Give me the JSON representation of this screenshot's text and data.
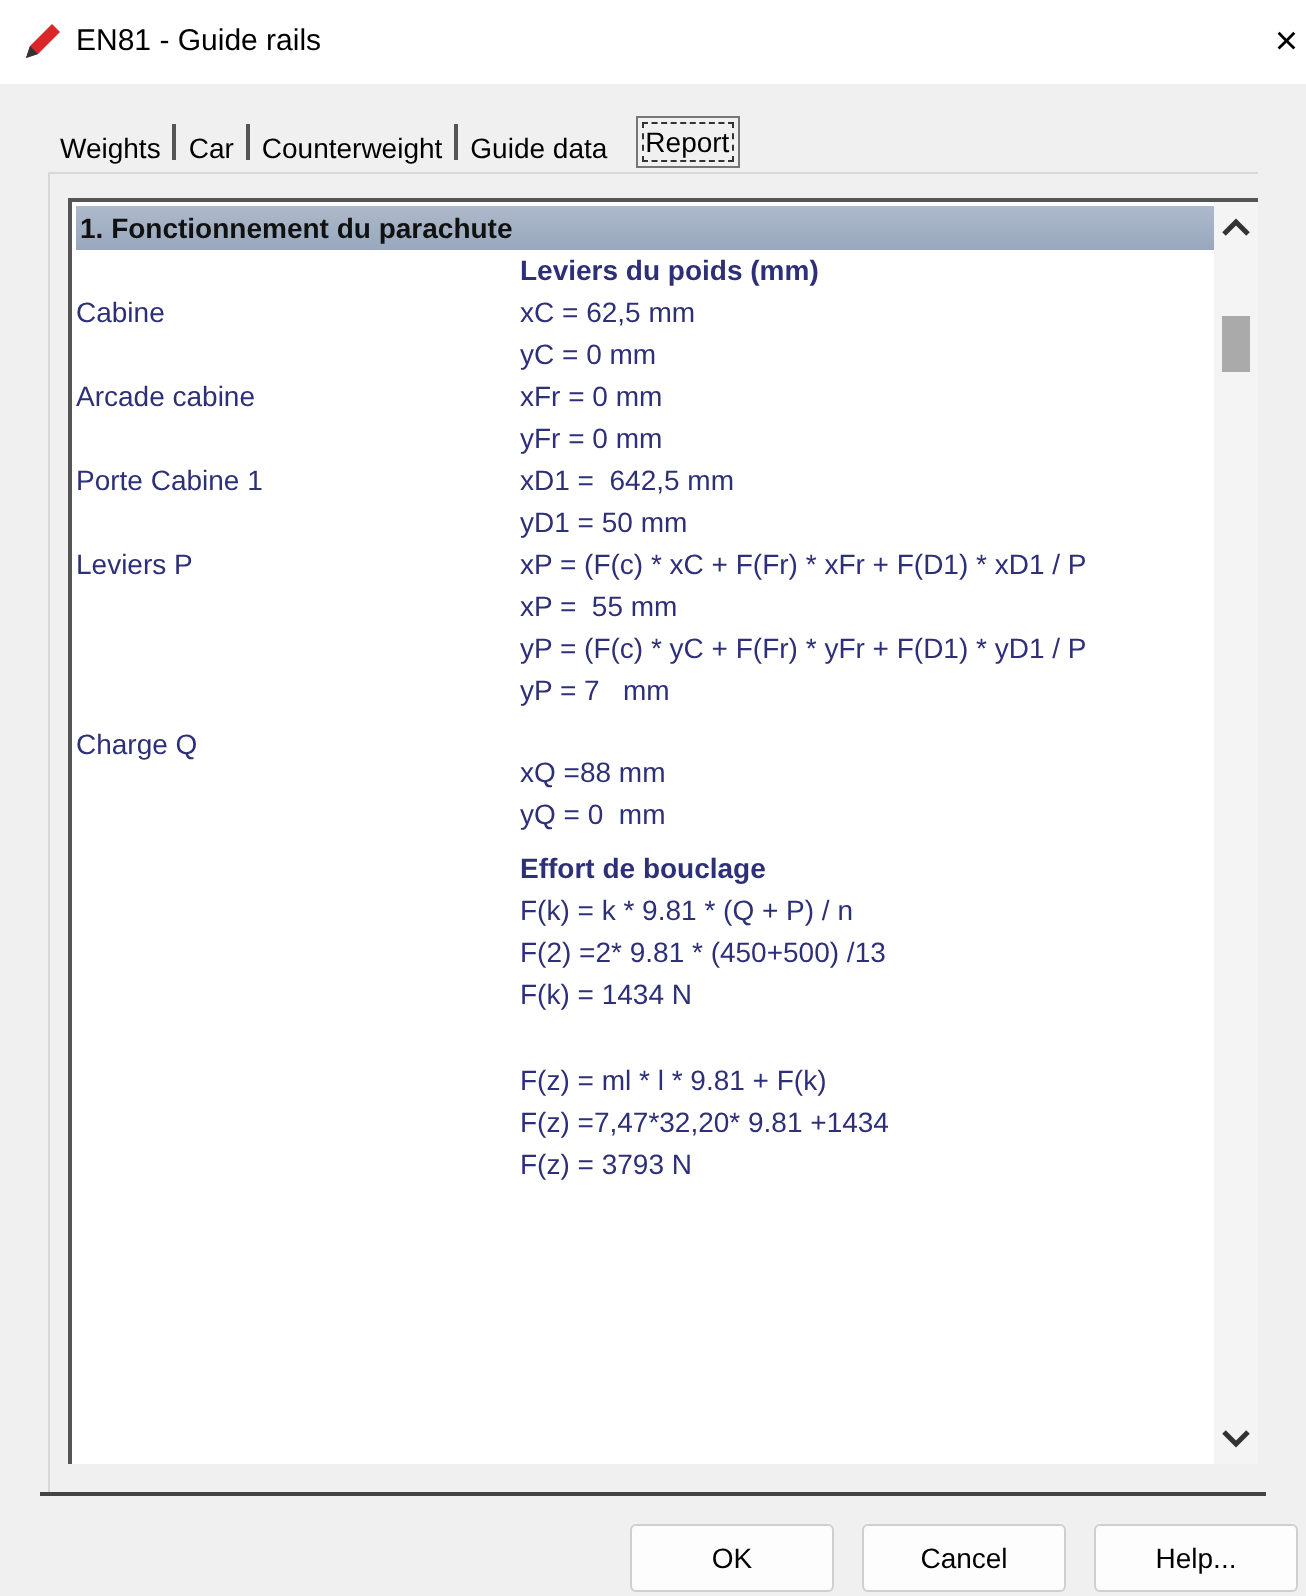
{
  "window": {
    "title": "EN81 - Guide rails",
    "close": "×"
  },
  "tabs": [
    {
      "label": "Weights",
      "selected": false
    },
    {
      "label": "Car",
      "selected": false
    },
    {
      "label": "Counterweight",
      "selected": false
    },
    {
      "label": "Guide data",
      "selected": false
    },
    {
      "label": "Report",
      "selected": true
    }
  ],
  "report": {
    "section_title": "1. Fonctionnement du parachute",
    "groups": [
      {
        "blank_line_before": false,
        "lines": [
          {
            "kind": "heading",
            "value": "Leviers du poids (mm)"
          },
          {
            "kind": "formula",
            "label": "Cabine",
            "value": "xC = 62,5 mm"
          },
          {
            "kind": "formula",
            "value": "yC = 0 mm"
          },
          {
            "kind": "formula",
            "label": "Arcade cabine",
            "value": "xFr = 0 mm"
          },
          {
            "kind": "formula",
            "value": "yFr = 0 mm"
          },
          {
            "kind": "formula",
            "label": "Porte Cabine 1",
            "value": "xD1 =  642,5 mm"
          },
          {
            "kind": "formula",
            "value": "yD1 = 50 mm"
          },
          {
            "kind": "formula",
            "label": "Leviers P",
            "value": "xP = (F(c) * xC + F(Fr) * xFr + F(D1) * xD1 / P"
          },
          {
            "kind": "formula",
            "value": "xP =  55 mm"
          },
          {
            "kind": "formula",
            "value": "yP = (F(c) * yC + F(Fr) * yFr + F(D1) * yD1 / P"
          },
          {
            "kind": "formula",
            "value": "yP = 7   mm"
          }
        ]
      },
      {
        "blank_line_before": false,
        "lines": [
          {
            "kind": "label",
            "label": "Charge Q"
          },
          {
            "kind": "formula",
            "value": "xQ =88 mm"
          },
          {
            "kind": "formula",
            "value": "yQ = 0  mm"
          }
        ]
      },
      {
        "blank_line_before": false,
        "lines": [
          {
            "kind": "heading",
            "value": "Effort de bouclage"
          },
          {
            "kind": "formula",
            "value": "F(k) = k * 9.81 * (Q + P) / n"
          },
          {
            "kind": "formula",
            "value": "F(2) =2* 9.81 * (450+500) /13"
          },
          {
            "kind": "formula",
            "value": "F(k) = 1434 N"
          }
        ]
      },
      {
        "blank_line_before": true,
        "lines": [
          {
            "kind": "formula",
            "value": "F(z) = ml * l * 9.81 + F(k)"
          },
          {
            "kind": "formula",
            "value": "F(z) =7,47*32,20* 9.81 +1434"
          },
          {
            "kind": "formula",
            "value": "F(z) = 3793 N"
          }
        ]
      }
    ]
  },
  "buttons": [
    "OK",
    "Cancel",
    "Help..."
  ]
}
